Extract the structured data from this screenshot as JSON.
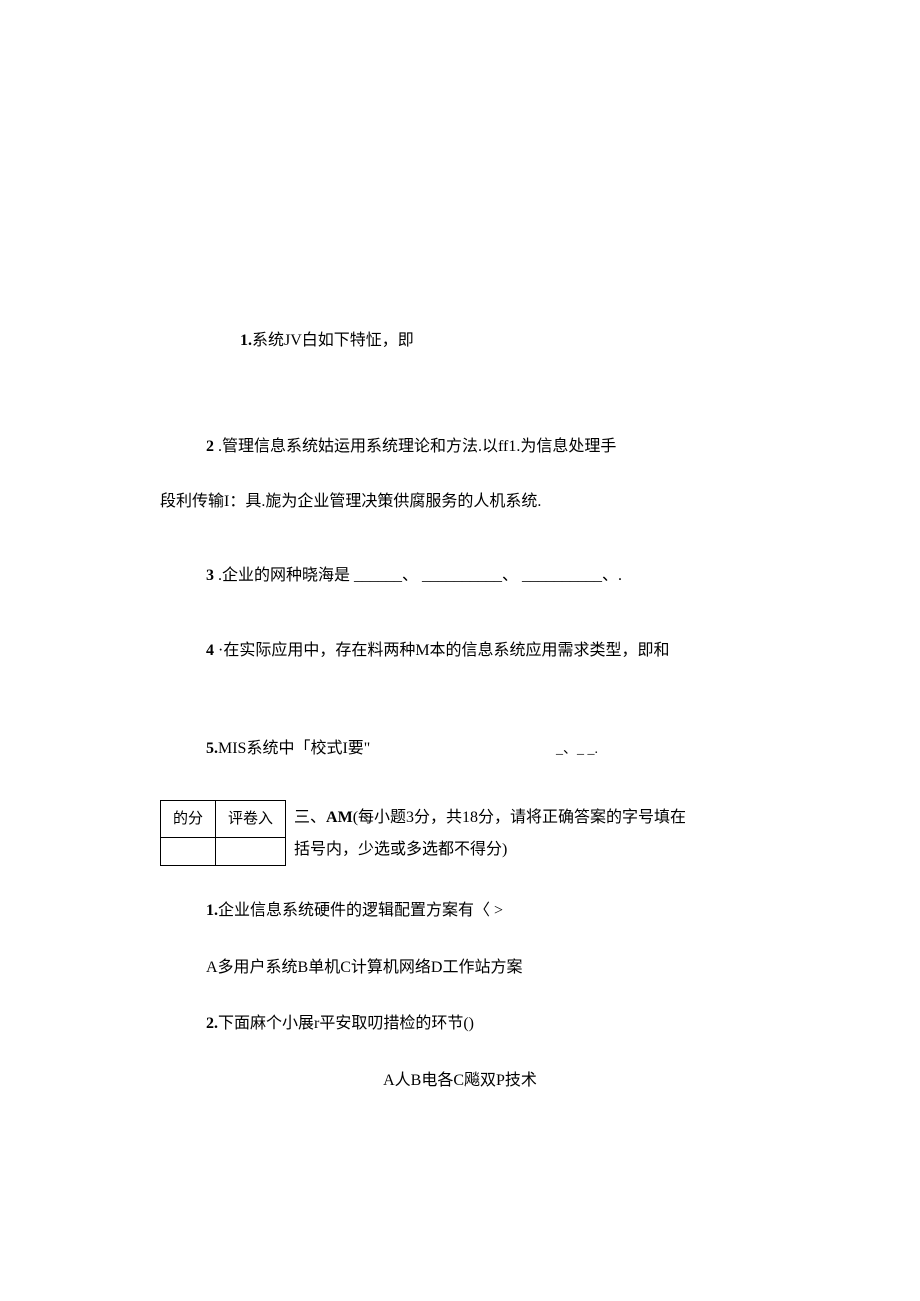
{
  "q1": {
    "num": "1.",
    "text": "系统JV白如下特怔，即"
  },
  "q2": {
    "num": "2",
    "line1": " .管理信息系统姑运用系统理论和方法.以ff1.为信息处理手",
    "line2": "段利传输I：具.旎为企业管理决策供腐服务的人机系统."
  },
  "q3": {
    "num": "3",
    "text": " .企业的网种晓海是 ______、 __________、 __________、."
  },
  "q4": {
    "num": "4",
    "text": " ·在实际应用中，存在料两种M本的信息系统应用需求类型，即和"
  },
  "q5": {
    "num": "5.",
    "text": "MIS系统中「校式I要\"",
    "blanks": "_、_                _."
  },
  "section3": {
    "table": {
      "c1": "的分",
      "c2": "评卷入"
    },
    "line1_a": "三、",
    "line1_b": "AM",
    "line1_c": "(每小题3分，共18分，请将正确答案的字号填在",
    "line2": "括号内，少选或多选都不得分)"
  },
  "mc1": {
    "q_num": "1.",
    "q_text": "企业信息系统硬件的逻辑配置方案有〈 >",
    "opt": "A多用户系统B单机C计算机网络D工作站方案"
  },
  "mc2": {
    "q_num": "2.",
    "q_text": "下面麻个小展r平安取叨措检的环节()",
    "opt": "A人B电各C飚双P技术"
  }
}
